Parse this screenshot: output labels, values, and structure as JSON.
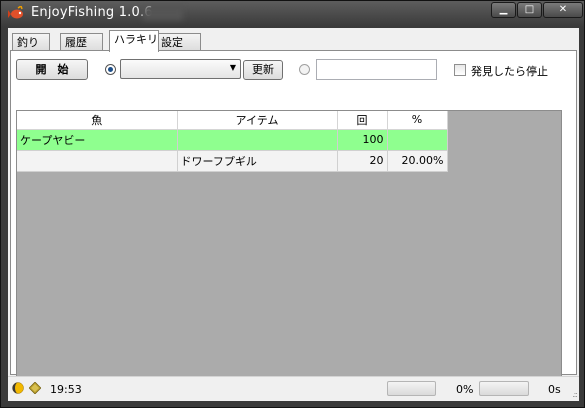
{
  "window": {
    "title": "EnjoyFishing 1.0.6",
    "minimize_label": "▁",
    "maximize_label": "□",
    "close_label": "✕"
  },
  "tabs": [
    {
      "label": "釣り"
    },
    {
      "label": "履歴"
    },
    {
      "label": "ハラキリ",
      "active": true
    },
    {
      "label": "設定"
    }
  ],
  "toolbar": {
    "start_label": "開　始",
    "combo_value": "",
    "update_label": "更新",
    "text_value": "",
    "stop_on_find_label": "発見したら停止"
  },
  "table": {
    "columns": [
      "魚",
      "アイテム",
      "回",
      "%"
    ],
    "rows": [
      {
        "fish": "ケープヤビー",
        "item": "",
        "count": "100",
        "percent": ""
      },
      {
        "fish": "",
        "item": "ドワーフプギル",
        "count": "20",
        "percent": "20.00%"
      }
    ]
  },
  "status": {
    "time": "19:53",
    "progress_percent_label": "0%",
    "seconds_label": "0s",
    "progress1": 0,
    "progress2": 0
  },
  "colors": {
    "selected_row": "#8fff8f",
    "grid_background": "#ababab"
  }
}
